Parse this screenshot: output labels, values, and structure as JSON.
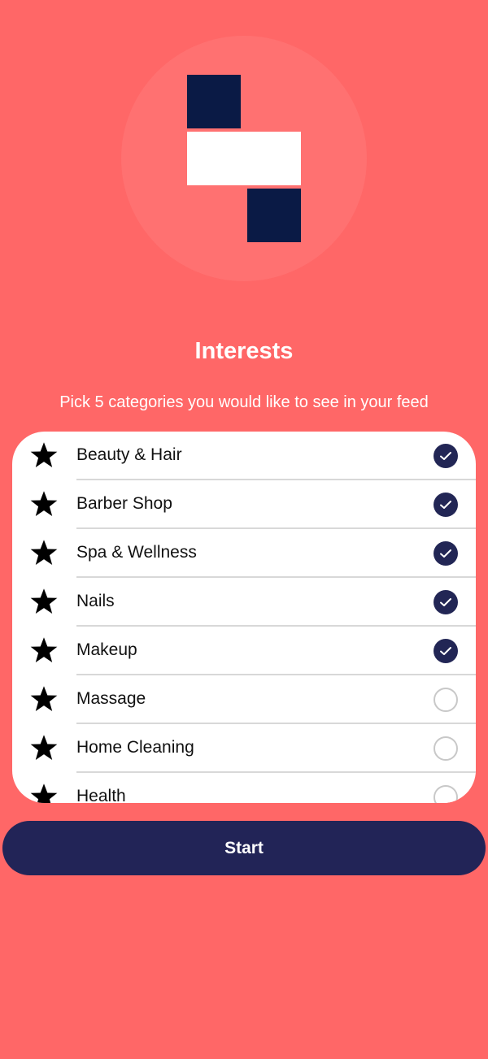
{
  "header": {
    "logo_icon": "app-logo-blocks",
    "title": "Interests",
    "subtitle": "Pick 5 categories you would like to see in your feed"
  },
  "categories": [
    {
      "label": "Beauty & Hair",
      "selected": true,
      "icon": "star-icon"
    },
    {
      "label": "Barber Shop",
      "selected": true,
      "icon": "star-icon"
    },
    {
      "label": "Spa & Wellness",
      "selected": true,
      "icon": "star-icon"
    },
    {
      "label": "Nails",
      "selected": true,
      "icon": "star-icon"
    },
    {
      "label": "Makeup",
      "selected": true,
      "icon": "star-icon"
    },
    {
      "label": "Massage",
      "selected": false,
      "icon": "star-icon"
    },
    {
      "label": "Home Cleaning",
      "selected": false,
      "icon": "star-icon"
    },
    {
      "label": "Health",
      "selected": false,
      "icon": "star-icon"
    }
  ],
  "actions": {
    "start_label": "Start"
  },
  "colors": {
    "background": "#FF6767",
    "navy": "#222457",
    "logo_dark": "#0A1A45",
    "card": "#FFFFFF"
  }
}
